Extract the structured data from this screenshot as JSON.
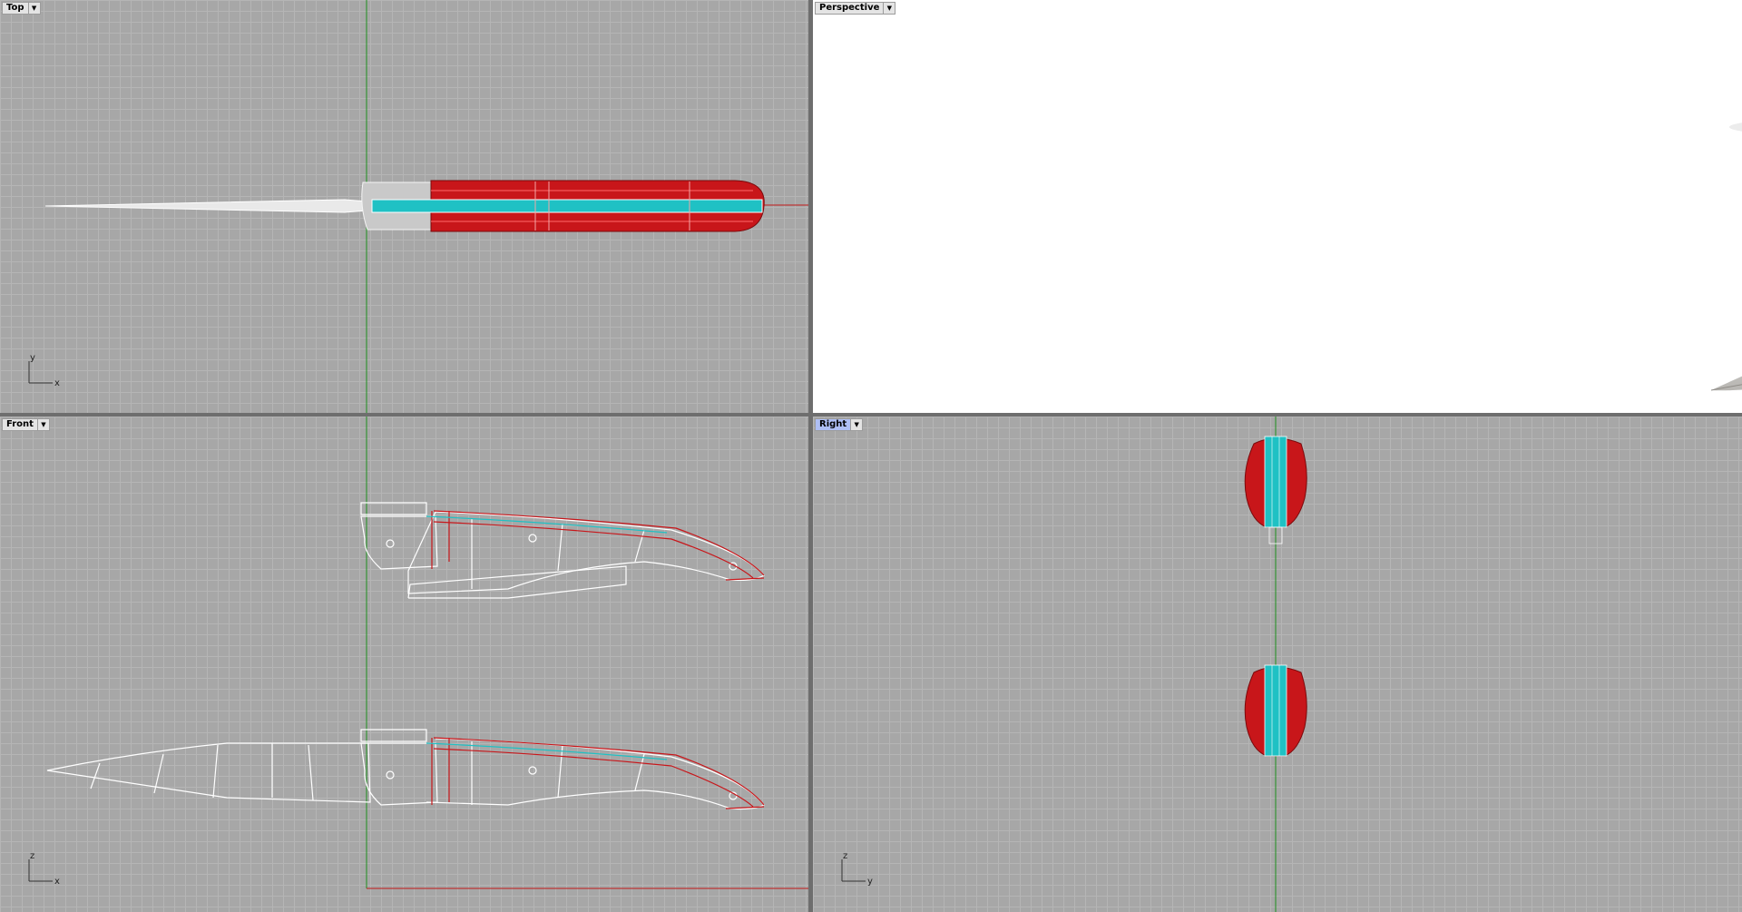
{
  "viewports": {
    "top": {
      "label": "Top",
      "axis_v": "y",
      "axis_h": "x"
    },
    "perspective": {
      "label": "Perspective"
    },
    "front": {
      "label": "Front",
      "axis_v": "z",
      "axis_h": "x"
    },
    "right": {
      "label": "Right",
      "axis_v": "z",
      "axis_h": "y"
    }
  },
  "icons": {
    "viewport_menu": "chevron-down-icon"
  },
  "colors": {
    "grid_bg": "#a7a7a7",
    "active_label": "#aebff5",
    "handle_red": "#c8161a",
    "liner_cyan": "#1fc1c4",
    "x_axis": "#c01818",
    "y_axis": "#1e8f1e"
  }
}
